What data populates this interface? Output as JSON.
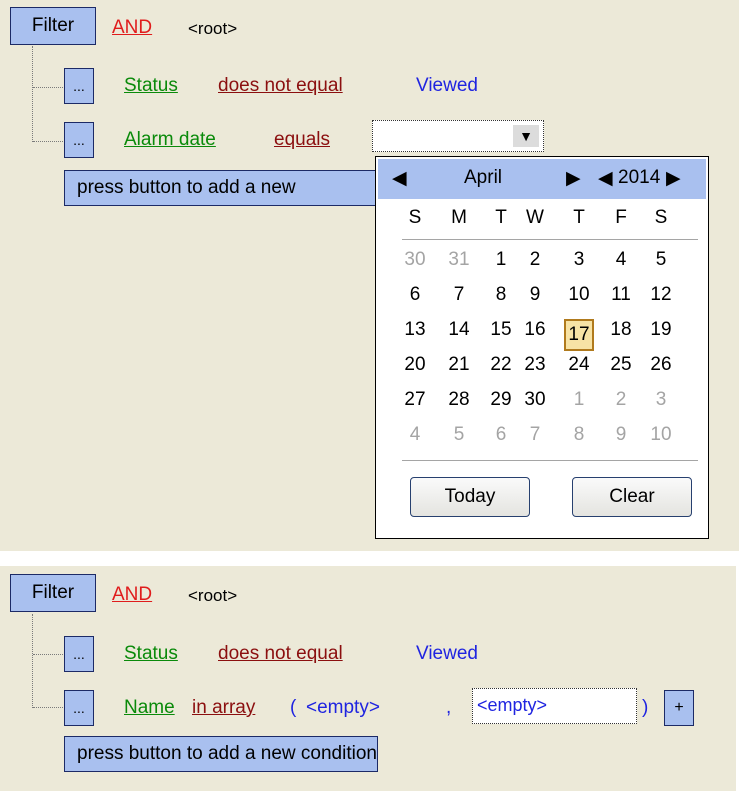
{
  "panel1": {
    "filter_label": "Filter",
    "group_op": "AND",
    "root": "<root>",
    "row1": {
      "btn": "...",
      "field": "Status",
      "op": "does not equal",
      "value": "Viewed"
    },
    "row2": {
      "btn": "...",
      "field": "Alarm date",
      "op": "equals",
      "date_value": "",
      "dropdown_arrow": "▼"
    },
    "add_condition_visible": "press button to add a new"
  },
  "calendar": {
    "prev_month": "◀",
    "month": "April",
    "next_month": "▶",
    "prev_year": "◀",
    "year": "2014",
    "next_year": "▶",
    "weekdays": [
      "S",
      "M",
      "T",
      "W",
      "T",
      "F",
      "S"
    ],
    "weeks": [
      [
        "30",
        "31",
        "1",
        "2",
        "3",
        "4",
        "5"
      ],
      [
        "6",
        "7",
        "8",
        "9",
        "10",
        "11",
        "12"
      ],
      [
        "13",
        "14",
        "15",
        "16",
        "17",
        "18",
        "19"
      ],
      [
        "20",
        "21",
        "22",
        "23",
        "24",
        "25",
        "26"
      ],
      [
        "27",
        "28",
        "29",
        "30",
        "1",
        "2",
        "3"
      ],
      [
        "4",
        "5",
        "6",
        "7",
        "8",
        "9",
        "10"
      ]
    ],
    "selected_day": "17",
    "today_label": "Today",
    "clear_label": "Clear"
  },
  "panel2": {
    "filter_label": "Filter",
    "group_op": "AND",
    "root": "<root>",
    "row1": {
      "btn": "...",
      "field": "Status",
      "op": "does not equal",
      "value": "Viewed"
    },
    "row2": {
      "btn": "...",
      "field": "Name",
      "op": "in array",
      "open_paren": "(",
      "item1": "<empty>",
      "comma": ",",
      "item2": "<empty>",
      "close_paren": ")",
      "add": "+"
    },
    "add_condition": "press button to add a new condition"
  },
  "colors": {
    "button_fill": "#a9c0ef",
    "panel_bg": "#ece9d8",
    "field": "#0a8a0a",
    "operator": "#8b0f0f",
    "group_op": "#e01c1c",
    "value": "#1f24e0",
    "today_highlight": "#f7e3a5"
  }
}
